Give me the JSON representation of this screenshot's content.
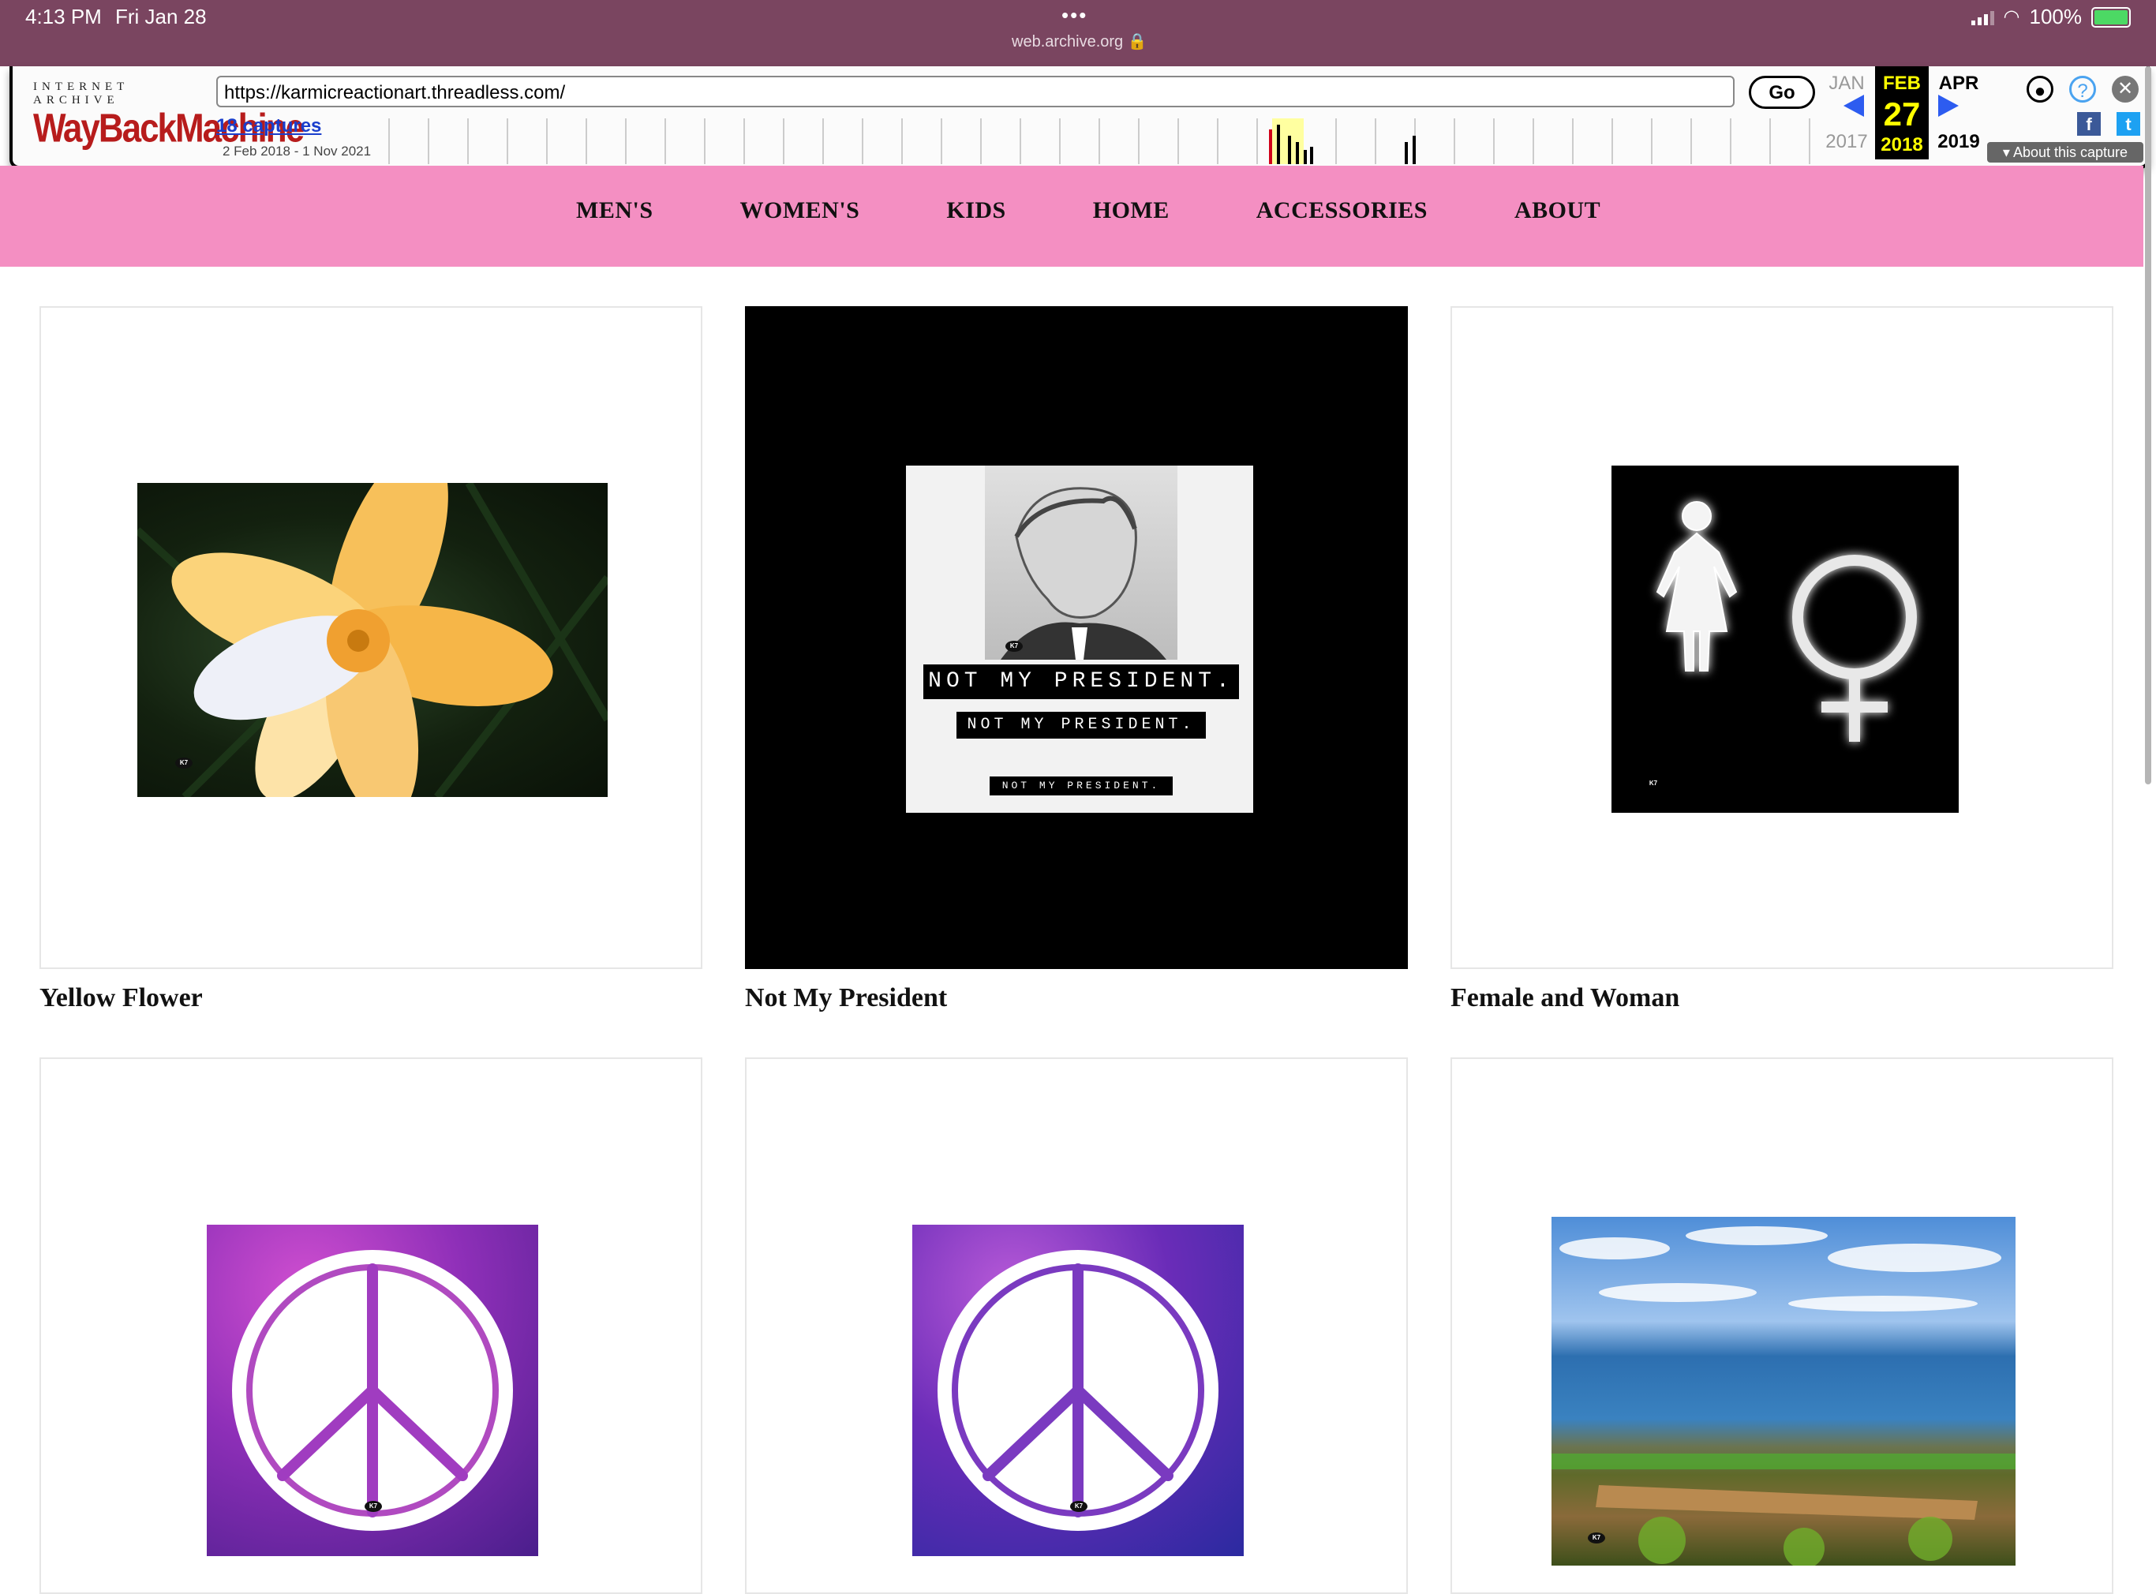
{
  "status_bar": {
    "time": "4:13 PM",
    "date": "Fri Jan 28",
    "dots": "•••",
    "host": "web.archive.org 🔒",
    "battery": "100%"
  },
  "wayback": {
    "logo_top": "INTERNET ARCHIVE",
    "logo_main": "WayBackMachine",
    "url": "https://karmicreactionart.threadless.com/",
    "go_label": "Go",
    "captures": "18 captures",
    "range": "2 Feb 2018 - 1 Nov 2021",
    "prev_month": "JAN",
    "prev_year": "2017",
    "cur_month": "FEB",
    "cur_day": "27",
    "cur_year": "2018",
    "next_month": "APR",
    "next_year": "2019",
    "about_capture": "▾ About this capture",
    "icons": [
      "user-icon",
      "help-icon",
      "close-icon",
      "facebook-icon",
      "twitter-icon"
    ]
  },
  "nav": {
    "items": [
      "MEN'S",
      "WOMEN'S",
      "KIDS",
      "HOME",
      "ACCESSORIES",
      "ABOUT"
    ]
  },
  "products": [
    {
      "title": "Yellow Flower",
      "artwork": "yellow-flower"
    },
    {
      "title": "Not My President",
      "artwork": "not-my-president"
    },
    {
      "title": "Female and Woman",
      "artwork": "female-symbols"
    },
    {
      "title": "",
      "artwork": "peace-sign-pink"
    },
    {
      "title": "",
      "artwork": "peace-sign-blue"
    },
    {
      "title": "",
      "artwork": "lake-shore"
    }
  ],
  "artwork_text": {
    "nmp_line": "NOT MY PRESIDENT.",
    "k7": "K7"
  },
  "colors": {
    "status_bar": "#7a4560",
    "nav_pink": "#f48fc2",
    "wayback_red": "#b71c1c",
    "wayback_link": "#1a3ecc",
    "calendar_highlight": "#ffff00"
  }
}
